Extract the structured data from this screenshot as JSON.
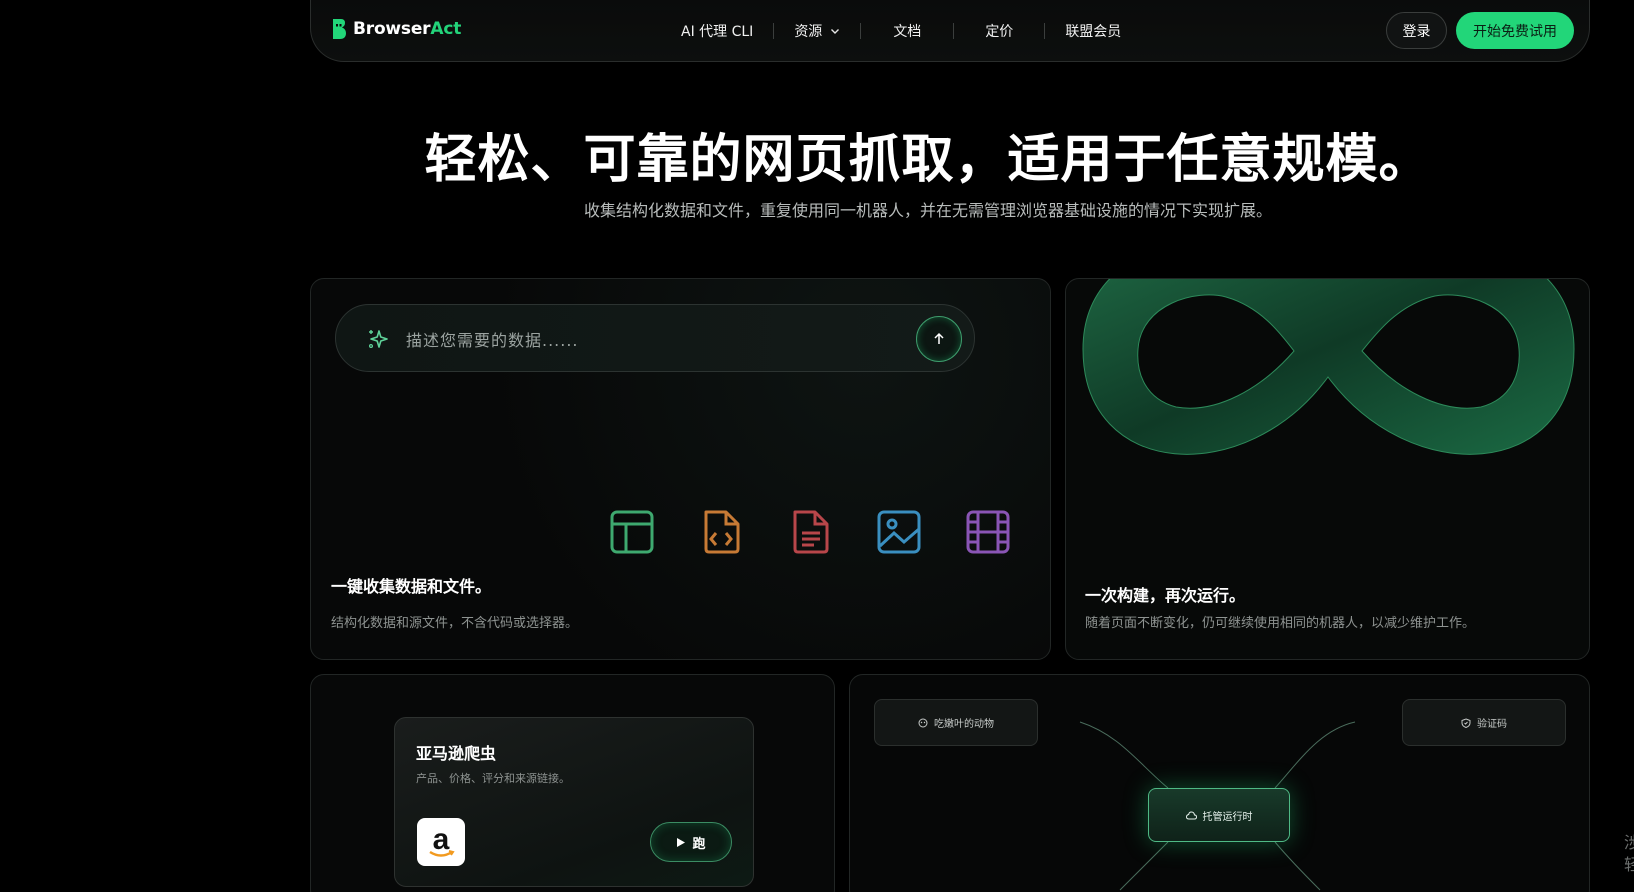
{
  "brand": {
    "name_prefix": "Browser",
    "name_suffix": "Act"
  },
  "nav": {
    "items": [
      "AI 代理 CLI",
      "资源",
      "文档",
      "定价",
      "联盟会员"
    ],
    "login": "登录",
    "trial": "开始免费试用"
  },
  "hero": {
    "title": "轻松、可靠的网页抓取，适用于任意规模。",
    "subtitle": "收集结构化数据和文件，重复使用同一机器人，并在无需管理浏览器基础设施的情况下实现扩展。"
  },
  "card_collect": {
    "search_placeholder": "描述您需要的数据......",
    "title": "一键收集数据和文件。",
    "desc": "结构化数据和源文件，不含代码或选择器。"
  },
  "card_build": {
    "title": "一次构建，再次运行。",
    "desc": "随着页面不断变化，仍可继续使用相同的机器人，以减少维护工作。"
  },
  "card_amazon": {
    "title": "亚马逊爬虫",
    "desc": "产品、价格、评分和来源链接。",
    "run": "跑"
  },
  "card_runtime": {
    "tag_left": "吃嫩叶的动物",
    "tag_right": "验证码",
    "hub": "托管运行时"
  },
  "edge_text": [
    "涉",
    "轻"
  ],
  "colors": {
    "accent": "#22d679",
    "background": "#000000"
  }
}
